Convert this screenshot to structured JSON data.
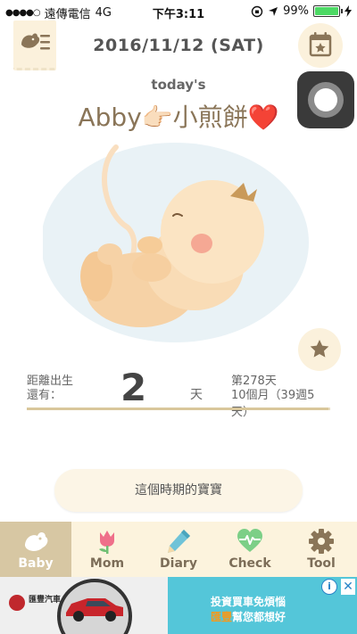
{
  "status_bar": {
    "signal": "●●●●○",
    "carrier": "遠傳電信",
    "network": "4G",
    "time": "下午3:11",
    "battery_percent": "99%"
  },
  "header": {
    "date": "2016/11/12 (SAT)",
    "today_label": "today's",
    "baby_name": "Abby👉🏻小煎餅❤️"
  },
  "countdown": {
    "label_line1": "距離出生",
    "label_line2": "還有：",
    "days_remaining": "2",
    "days_unit": "天",
    "day_count": "第278天",
    "month_week": "10個月（39週5天）",
    "progress_fraction": 0.993
  },
  "period_button": {
    "label": "這個時期的寶寶"
  },
  "tabs": [
    {
      "label": "Baby",
      "icon": "baby-bird-icon",
      "active": true
    },
    {
      "label": "Mom",
      "icon": "tulip-icon",
      "active": false
    },
    {
      "label": "Diary",
      "icon": "pencil-icon",
      "active": false
    },
    {
      "label": "Check",
      "icon": "heartbeat-icon",
      "active": false
    },
    {
      "label": "Tool",
      "icon": "gear-icon",
      "active": false
    }
  ],
  "ad": {
    "brand": "匯豐汽車",
    "line1": "投資買車免煩惱",
    "line2_highlight": "匯豐",
    "line2_rest": "幫您都想好"
  },
  "colors": {
    "accent_tan": "#d7c7a3",
    "cream": "#fcf3dd",
    "name_brown": "#8a7558",
    "ad_blue": "#54c6d9"
  }
}
